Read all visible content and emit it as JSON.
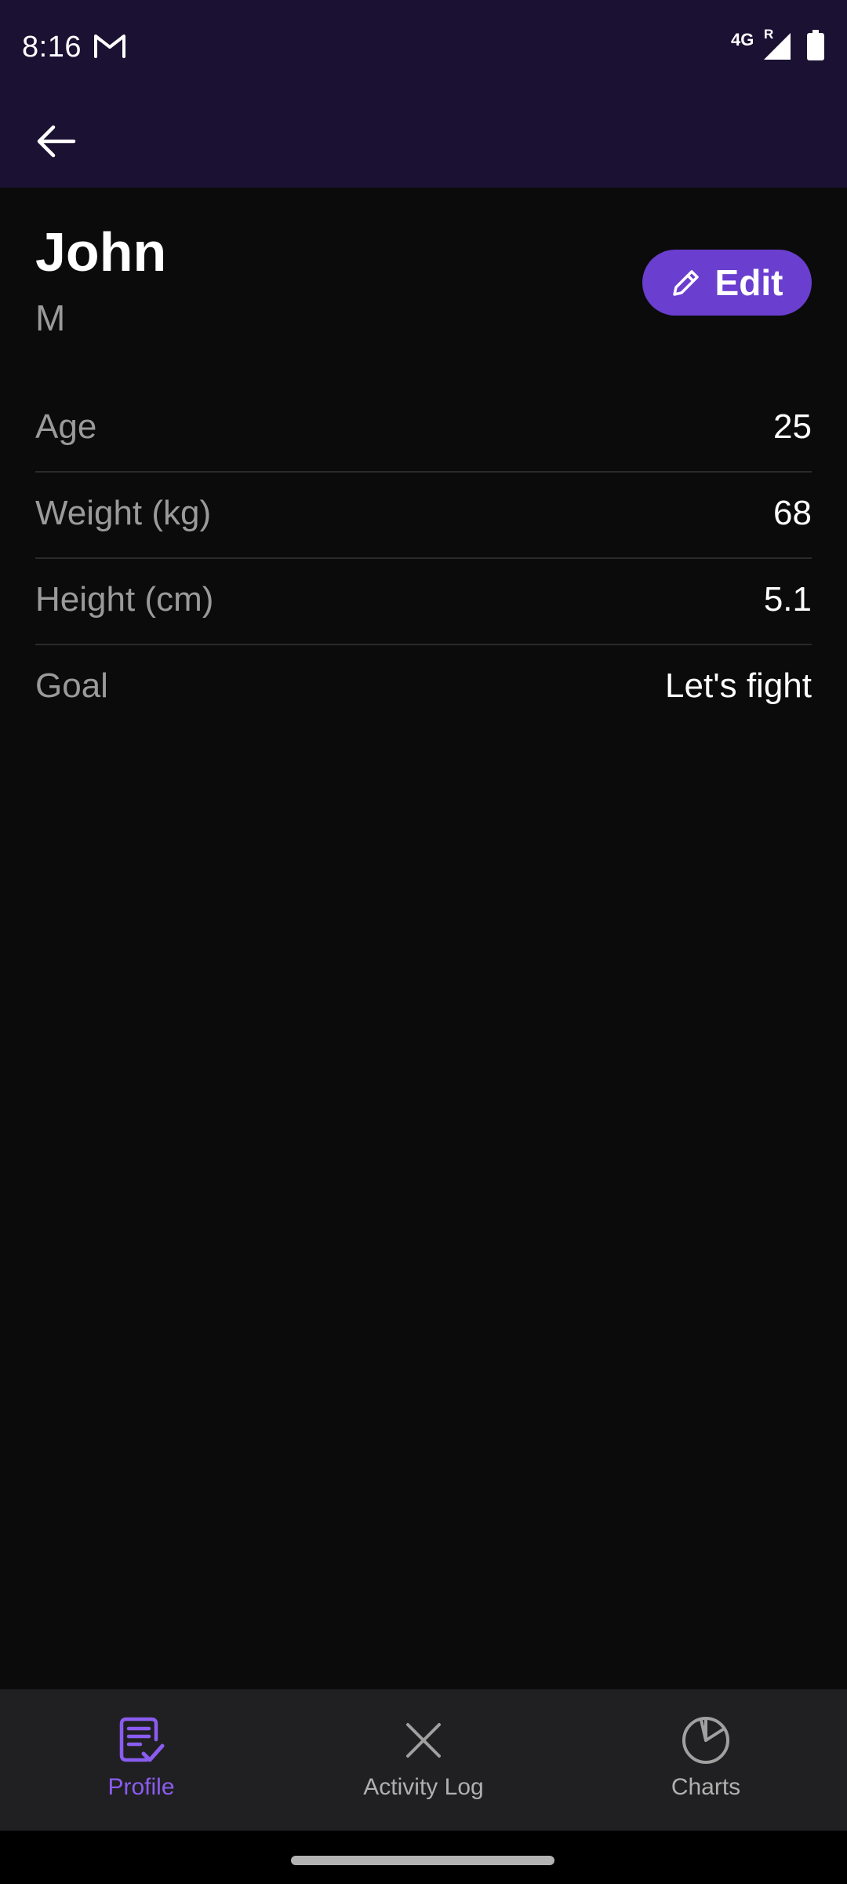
{
  "status_bar": {
    "time": "8:16",
    "network": "4G",
    "roaming": "R",
    "icons": [
      "gmail-icon",
      "signal-icon",
      "battery-icon"
    ]
  },
  "app_bar": {
    "back_icon": "arrow-left-icon"
  },
  "profile": {
    "name": "John",
    "gender": "M",
    "edit_label": "Edit",
    "edit_icon": "pencil-icon"
  },
  "details": [
    {
      "label": "Age",
      "value": "25"
    },
    {
      "label": "Weight (kg)",
      "value": "68"
    },
    {
      "label": "Height (cm)",
      "value": "5.1"
    },
    {
      "label": "Goal",
      "value": "Let's fight"
    }
  ],
  "bottom_nav": {
    "items": [
      {
        "label": "Profile",
        "icon": "profile-checklist-icon",
        "active": true
      },
      {
        "label": "Activity Log",
        "icon": "close-x-icon",
        "active": false
      },
      {
        "label": "Charts",
        "icon": "pie-chart-icon",
        "active": false
      }
    ]
  },
  "colors": {
    "top_bar": "#1b1132",
    "background": "#0b0b0c",
    "accent": "#6a3fd0",
    "active_nav": "#8b5cf0",
    "nav_background": "#202022",
    "muted_text": "#9a9a9a"
  }
}
